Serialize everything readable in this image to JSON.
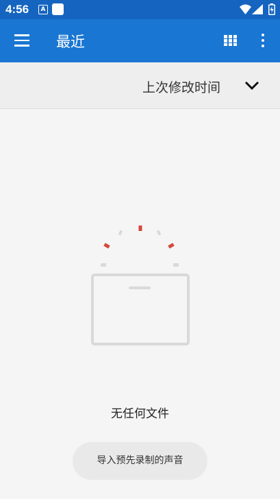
{
  "status_bar": {
    "time": "4:56",
    "notification_icon": "A",
    "icons": [
      "app-notification-icon",
      "wifi-icon",
      "signal-icon",
      "battery-icon"
    ]
  },
  "app_bar": {
    "title": "最近",
    "icons": [
      "menu-icon",
      "grid-view-icon",
      "more-vert-icon"
    ]
  },
  "sort": {
    "label": "上次修改时间",
    "icon": "chevron-down-icon"
  },
  "empty_state": {
    "message": "无任何文件",
    "icon": "empty-folder-icon"
  },
  "import_button": {
    "label": "导入预先录制的声音"
  },
  "colors": {
    "status_bar": "#1565c0",
    "app_bar": "#1976d2",
    "background": "#f5f5f5",
    "sort_bar": "#eeeeee",
    "accent_red": "#d9463b",
    "illustration_gray": "#d9d9d9"
  }
}
